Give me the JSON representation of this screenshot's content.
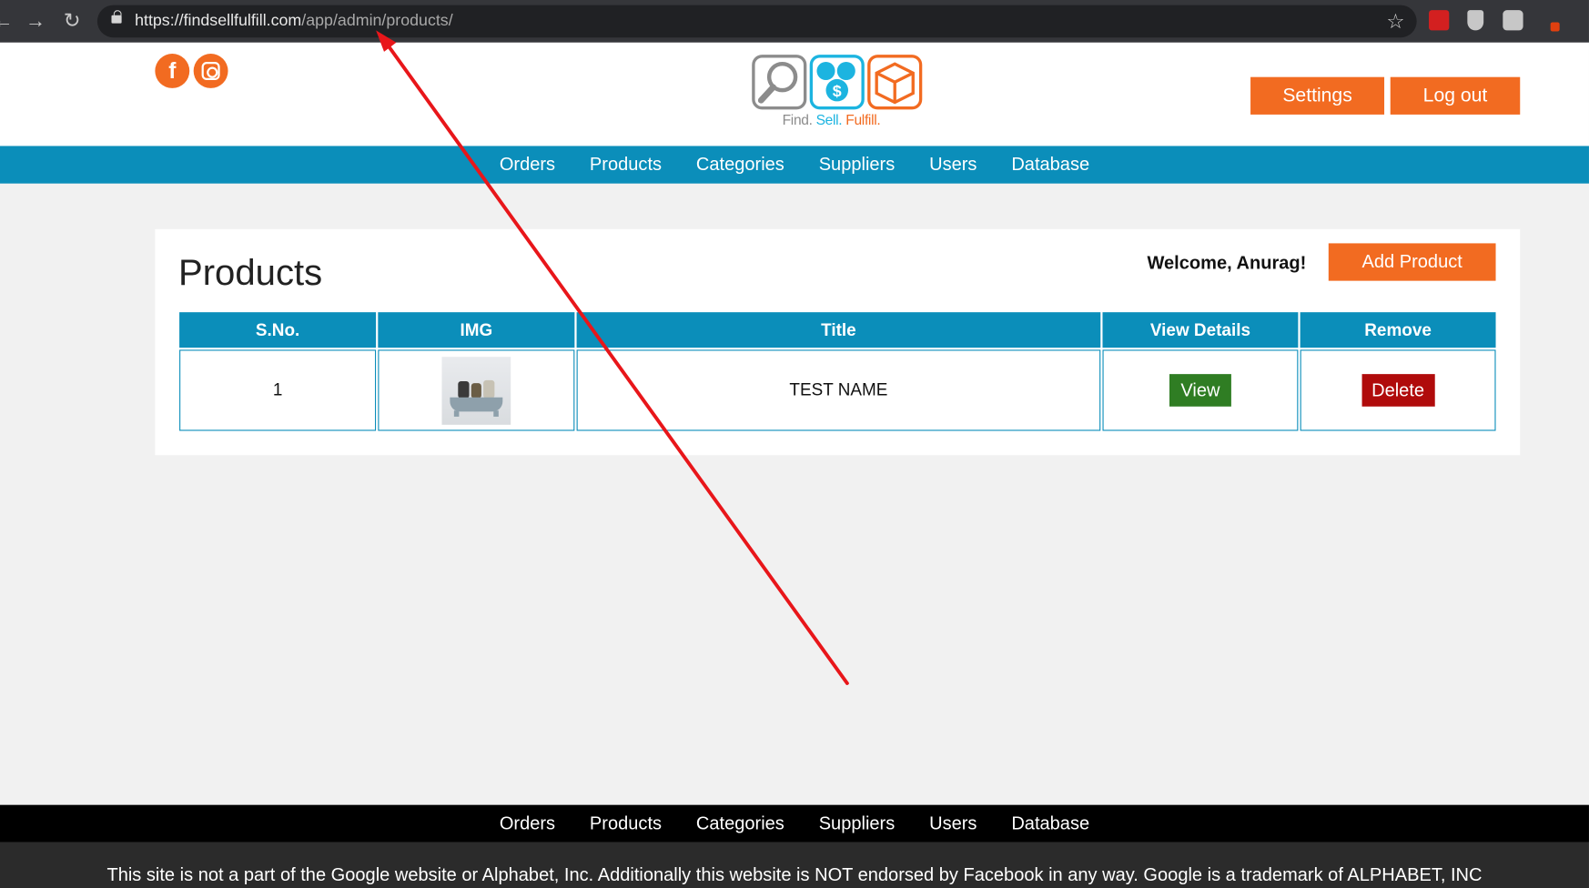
{
  "browser": {
    "url_main": "https://findsellfulfill.com",
    "url_path": "/app/admin/products/"
  },
  "header": {
    "logo_words": [
      "Find.",
      "Sell.",
      "Fulfill."
    ],
    "settings_label": "Settings",
    "logout_label": "Log out"
  },
  "nav": {
    "items": [
      "Orders",
      "Products",
      "Categories",
      "Suppliers",
      "Users",
      "Database"
    ]
  },
  "main": {
    "title": "Products",
    "welcome": "Welcome, Anurag!",
    "add_label": "Add Product",
    "table": {
      "headers": [
        "S.No.",
        "IMG",
        "Title",
        "View Details",
        "Remove"
      ],
      "rows": [
        {
          "sno": "1",
          "title": "TEST NAME",
          "view_label": "View",
          "delete_label": "Delete"
        }
      ]
    }
  },
  "footer": {
    "nav_items": [
      "Orders",
      "Products",
      "Categories",
      "Suppliers",
      "Users",
      "Database"
    ],
    "disclaimer": "This site is not a part of the Google website or Alphabet, Inc. Additionally this website is NOT endorsed by Facebook in any way. Google is a trademark of ALPHABET, INC"
  },
  "colors": {
    "brand_orange": "#f26b21",
    "brand_blue": "#0b8eba",
    "view_green": "#2f7d23",
    "delete_red": "#b00b0b",
    "annotation_red": "#e8161a"
  }
}
